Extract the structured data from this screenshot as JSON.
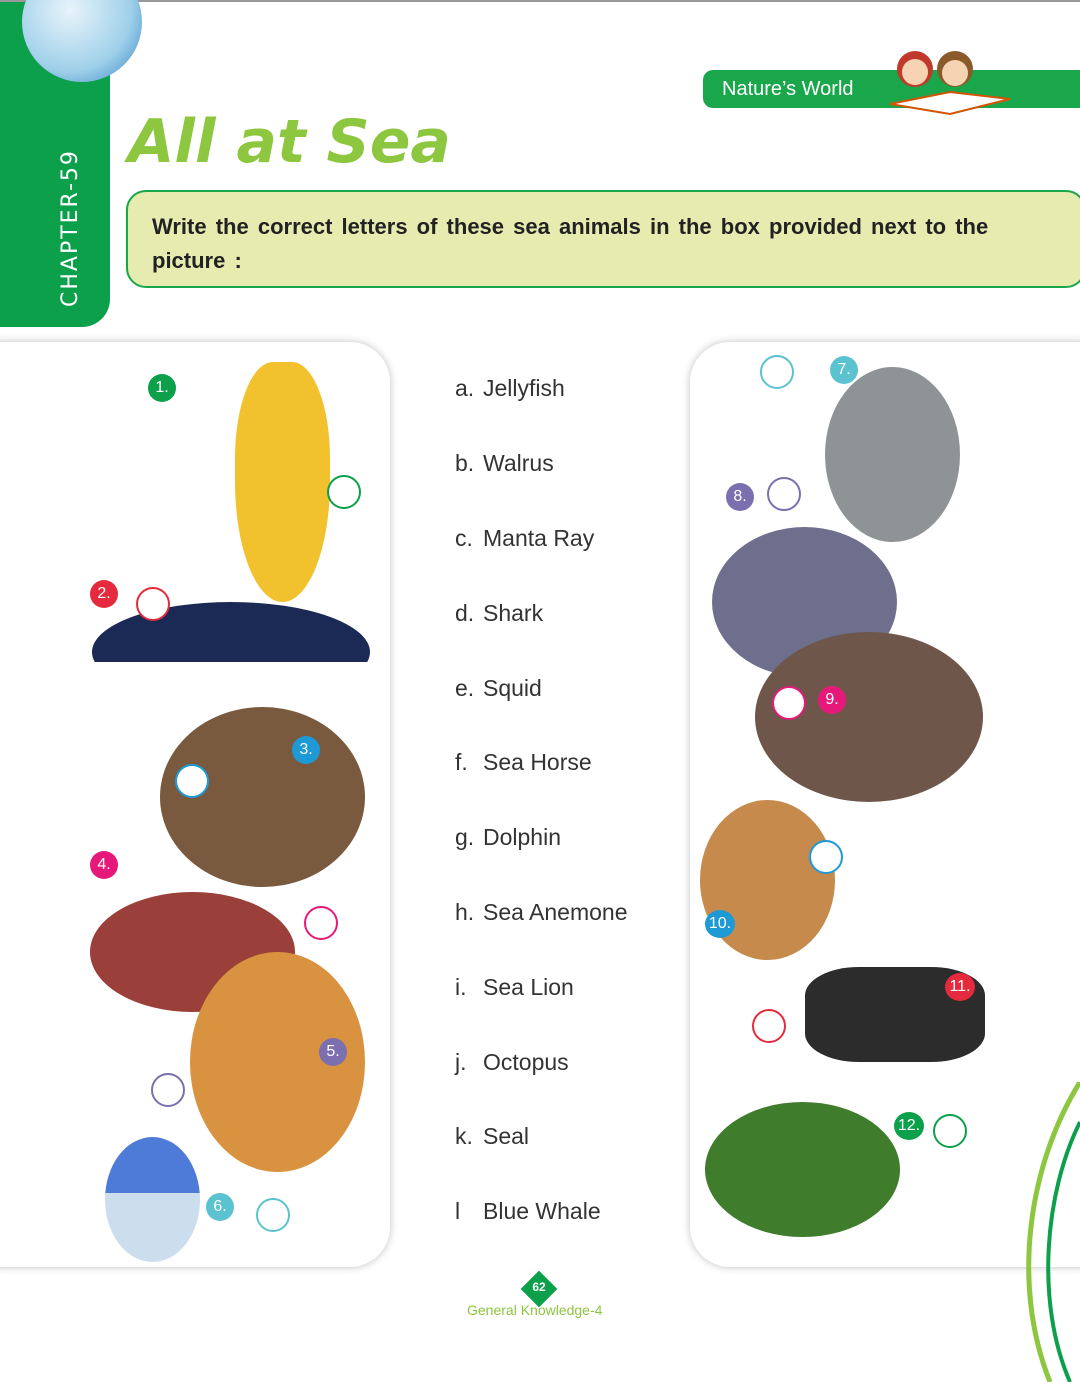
{
  "header": {
    "chapter": "CHAPTER-59",
    "title": "All at Sea",
    "series": "Nature’s World"
  },
  "instruction": "Write the correct letters of these sea animals in the box provided next to the picture :",
  "options": [
    {
      "letter": "a.",
      "name": "Jellyfish"
    },
    {
      "letter": "b.",
      "name": "Walrus"
    },
    {
      "letter": "c.",
      "name": "Manta Ray"
    },
    {
      "letter": "d.",
      "name": "Shark"
    },
    {
      "letter": "e.",
      "name": "Squid"
    },
    {
      "letter": "f.",
      "name": "Sea Horse"
    },
    {
      "letter": "g.",
      "name": "Dolphin"
    },
    {
      "letter": "h.",
      "name": "Sea Anemone"
    },
    {
      "letter": "i.",
      "name": "Sea Lion"
    },
    {
      "letter": "j.",
      "name": "Octopus"
    },
    {
      "letter": "k.",
      "name": "Seal"
    },
    {
      "letter": "l",
      "name": "Blue Whale"
    }
  ],
  "pictures": [
    {
      "num": "1.",
      "color": "#0ca04b"
    },
    {
      "num": "2.",
      "color": "#e42a3c"
    },
    {
      "num": "3.",
      "color": "#1d9ad6"
    },
    {
      "num": "4.",
      "color": "#e6197a"
    },
    {
      "num": "5.",
      "color": "#7b6fb0"
    },
    {
      "num": "6.",
      "color": "#5bc3cf"
    },
    {
      "num": "7.",
      "color": "#5bc3cf"
    },
    {
      "num": "8.",
      "color": "#7b6fb0"
    },
    {
      "num": "9.",
      "color": "#e6197a"
    },
    {
      "num": "10.",
      "color": "#1d9ad6"
    },
    {
      "num": "11.",
      "color": "#e42a3c"
    },
    {
      "num": "12.",
      "color": "#0ca04b"
    }
  ],
  "footer": {
    "page": "62",
    "book": "General Knowledge-4"
  }
}
